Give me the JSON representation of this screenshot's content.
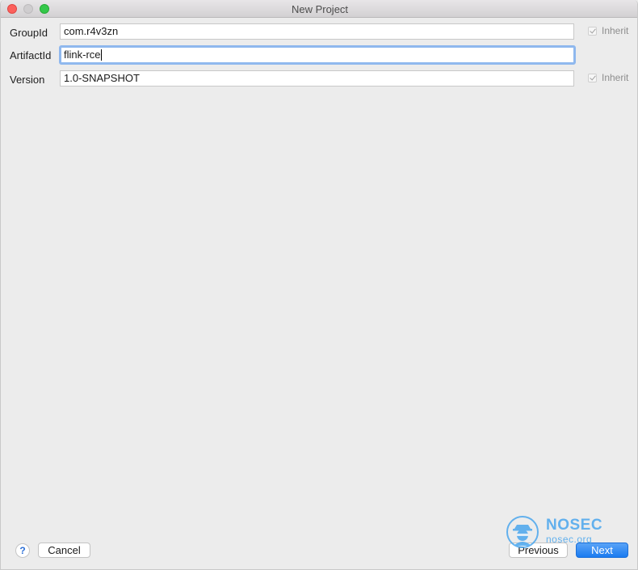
{
  "window": {
    "title": "New Project"
  },
  "form": {
    "group_id": {
      "label": "GroupId",
      "value": "com.r4v3zn",
      "inherit_label": "Inherit",
      "inherit_checked": true
    },
    "artifact_id": {
      "label": "ArtifactId",
      "value": "flink-rce"
    },
    "version": {
      "label": "Version",
      "value": "1.0-SNAPSHOT",
      "inherit_label": "Inherit",
      "inherit_checked": true
    }
  },
  "footer": {
    "help_label": "?",
    "cancel_label": "Cancel",
    "previous_label": "Previous",
    "next_label": "Next"
  },
  "watermark": {
    "name": "NOSEC",
    "url": "nosec.org"
  },
  "colors": {
    "accent": "#1a7bf0",
    "focus_ring": "#8fb8ee",
    "watermark": "#4aa6ee"
  }
}
